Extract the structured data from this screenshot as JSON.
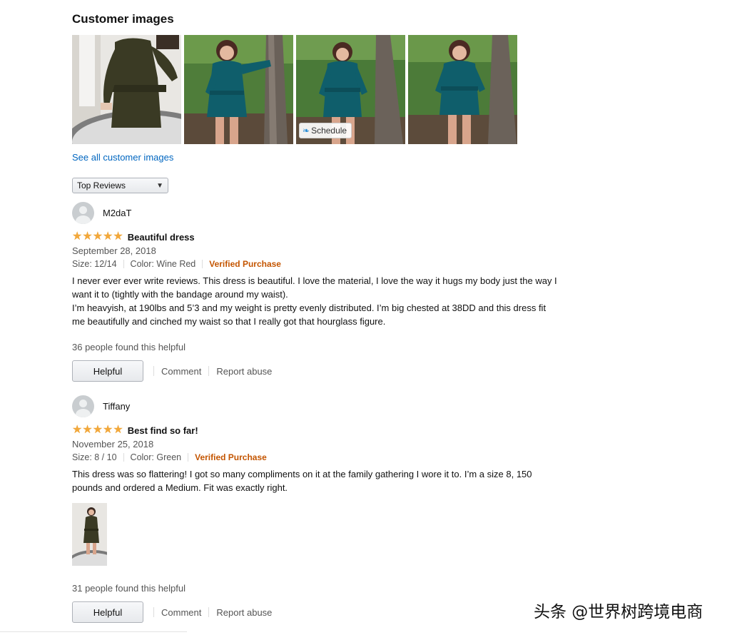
{
  "customer_images": {
    "title": "Customer images",
    "schedule_label": "Schedule",
    "see_all": "See all customer images"
  },
  "sort": {
    "selected": "Top Reviews"
  },
  "reviews": [
    {
      "author": "M2daT",
      "rating": 5,
      "title": "Beautiful dress",
      "date": "September 28, 2018",
      "size": "Size: 12/14",
      "color": "Color: Wine Red",
      "verified": "Verified Purchase",
      "body": [
        "I never ever ever write reviews. This dress is beautiful. I love the material, I love the way it hugs my body just the way I want it to (tightly with the bandage around my waist).",
        "I’m heavyish, at 190lbs and 5’3 and my weight is pretty evenly distributed. I’m big chested at 38DD and this dress fit me beautifully and cinched my waist so that I really got that hourglass figure."
      ],
      "helpful_count": "36 people found this helpful",
      "helpful_label": "Helpful",
      "comment_label": "Comment",
      "report_label": "Report abuse"
    },
    {
      "author": "Tiffany",
      "rating": 5,
      "title": "Best find so far!",
      "date": "November 25, 2018",
      "size": "Size: 8 / 10",
      "color": "Color: Green",
      "verified": "Verified Purchase",
      "body": [
        "This dress was so flattering! I got so many compliments on it at the family gathering I wore it to. I’m a size 8, 150 pounds and ordered a Medium. Fit was exactly right."
      ],
      "helpful_count": "31 people found this helpful",
      "helpful_label": "Helpful",
      "comment_label": "Comment",
      "report_label": "Report abuse"
    }
  ],
  "watermark": "头条 @世界树跨境电商",
  "colors": {
    "link": "#0066c0",
    "star": "#f2a83b",
    "verified": "#c45500",
    "dress_teal": "#0f5e6b",
    "dress_olive": "#3a3a24"
  },
  "icons": {
    "star": "star-icon",
    "avatar": "default-avatar-icon",
    "sort_chevron": "chevron-down-icon",
    "schedule": "schedule-bird-icon"
  }
}
